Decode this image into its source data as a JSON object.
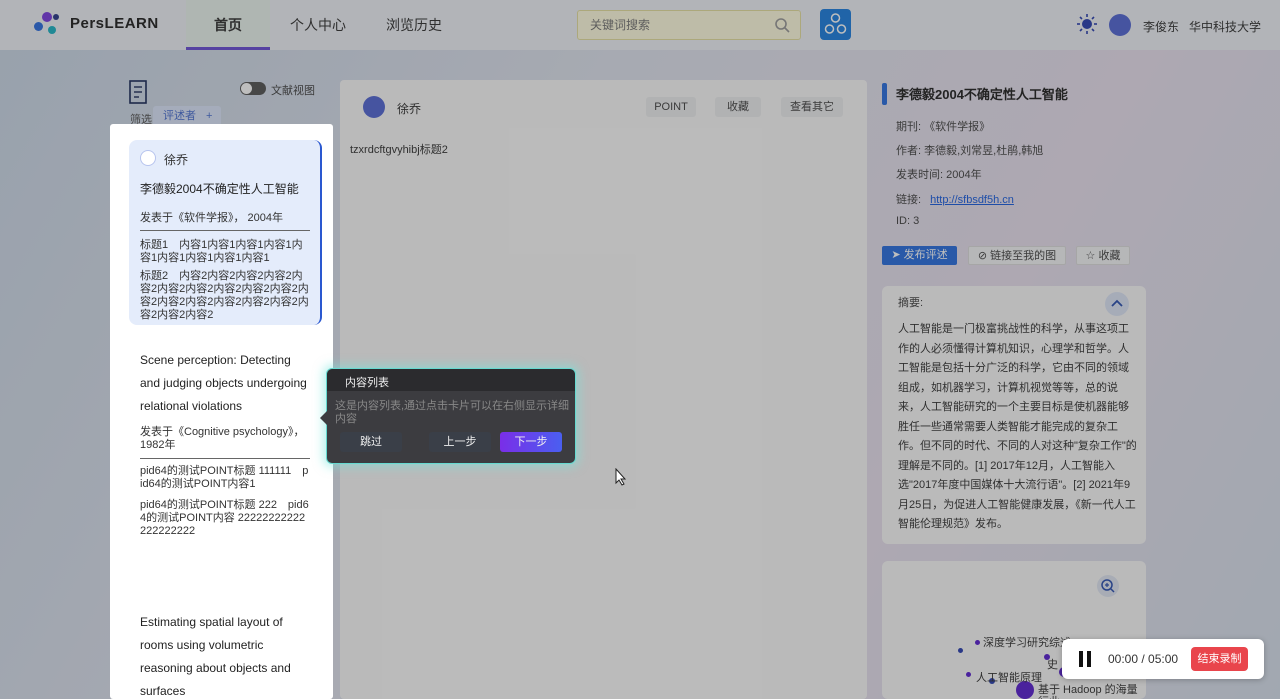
{
  "header": {
    "brand": "PersLEARN",
    "nav": [
      {
        "label": "首页",
        "active": true
      },
      {
        "label": "个人中心"
      },
      {
        "label": "浏览历史"
      }
    ],
    "search_placeholder": "关键词搜索",
    "user_name": "李俊东",
    "user_org": "华中科技大学"
  },
  "left": {
    "filter_label": "筛选",
    "reviewer_tag": "评述者",
    "toggle_label": "文献视图",
    "cards": [
      {
        "author": "徐乔",
        "title": "李德毅2004不确定性人工智能",
        "published": "发表于《软件学报》，  2004年",
        "lines": [
          "标题1　内容1内容1内容1内容1内容1内容1内容1内容1内容1",
          "标题2　内容2内容2内容2内容2内容2内容2内容2内容2内容2内容2内容2内容2内容2内容2内容2内容2内容2内容2内容2"
        ]
      },
      {
        "title": "Scene perception: Detecting and judging objects undergoing relational violations",
        "published": "发表于《Cognitive psychology》，1982年",
        "lines": [
          "pid64的测试POINT标题 111111　pid64的测试POINT内容1",
          "pid64的测试POINT标题 222　pid64的测试POINT内容 22222222222222222222"
        ]
      },
      {
        "title": "Estimating spatial layout of rooms using volumetric reasoning about objects and surfaces"
      }
    ]
  },
  "center": {
    "author": "徐乔",
    "buttons": [
      "POINT",
      "收藏",
      "查看其它"
    ],
    "body": "tzxrdcftgvyhibj标题2"
  },
  "right": {
    "title": "李德毅2004不确定性人工智能",
    "journal": "期刊:  《软件学报》",
    "authors": "作者:  李德毅,刘常昱,杜鹃,韩旭",
    "date": "发表时间:  2004年",
    "link_label": "链接:",
    "link": "http://sfbsdf5h.cn",
    "id": "ID: 3",
    "actions": [
      "发布评述",
      "链接至我的图",
      "收藏"
    ],
    "abstract_label": "摘要:",
    "abstract": "人工智能是一门极富挑战性的科学，从事这项工作的人必须懂得计算机知识，心理学和哲学。人工智能是包括十分广泛的科学，它由不同的领域组成，如机器学习，计算机视觉等等，总的说来，人工智能研究的一个主要目标是使机器能够胜任一些通常需要人类智能才能完成的复杂工作。但不同的时代、不同的人对这种\"复杂工作\"的理解是不同的。[1] 2017年12月，人工智能入选\"2017年度中国媒体十大流行语\"。[2] 2021年9月25日，为促进人工智能健康发展，《新一代人工智能伦理规范》发布。",
    "graph_labels": [
      "深度学习研究综述",
      "史",
      "人工智能原理",
      "基于 Hadoop 的海量",
      "行业"
    ]
  },
  "tour": {
    "title": "内容列表",
    "description": "这是内容列表,通过点击卡片可以在右侧显示详细内容",
    "skip": "跳过",
    "prev": "上一步",
    "next": "下一步"
  },
  "recorder": {
    "time": "00:00 / 05:00",
    "stop": "结束录制"
  },
  "colors": {
    "accent": "#2a6fe0",
    "next_button": "#6a3cf0",
    "stop": "#e9454c"
  }
}
